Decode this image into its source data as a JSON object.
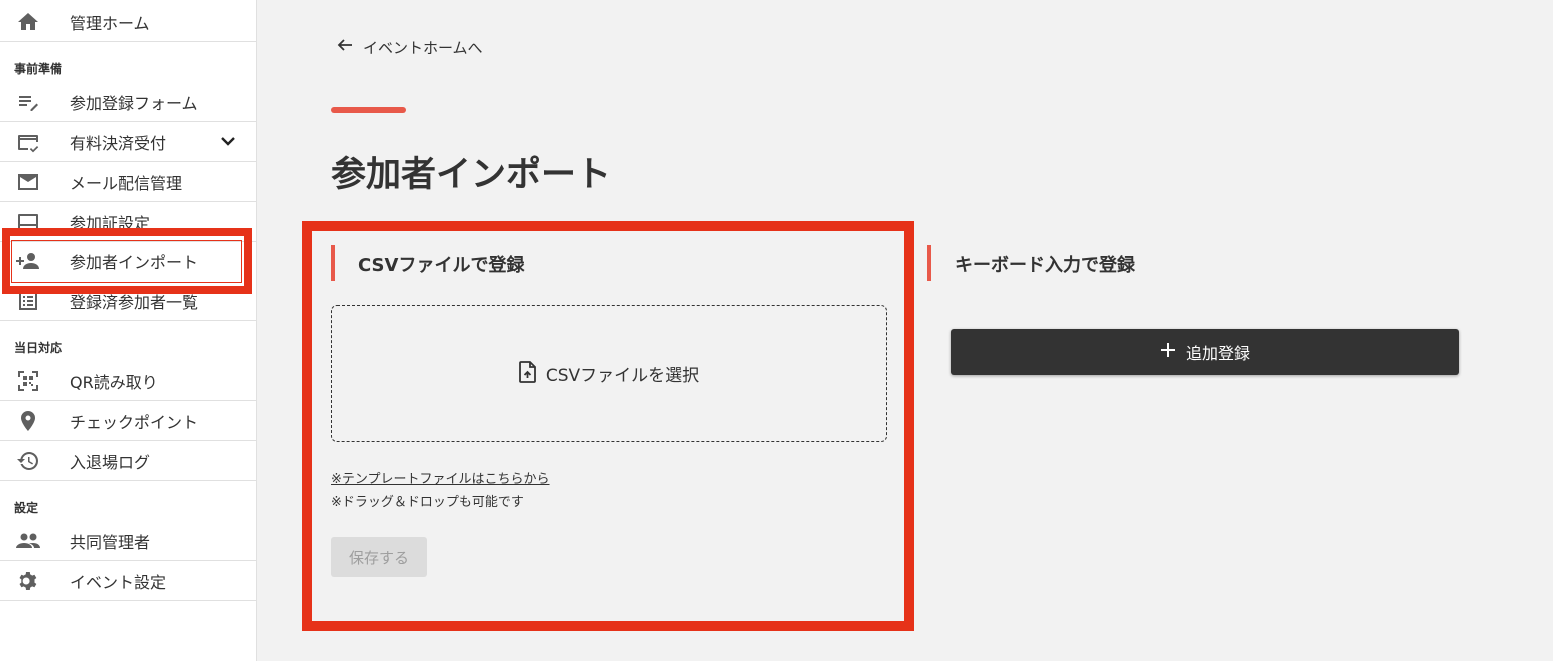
{
  "sidebar": {
    "items": [
      {
        "label": "管理ホーム",
        "icon": "home-icon"
      },
      {
        "label": "参加登録フォーム",
        "icon": "edit-note-icon"
      },
      {
        "label": "有料決済受付",
        "icon": "credit-card-check-icon"
      },
      {
        "label": "メール配信管理",
        "icon": "mail-icon"
      },
      {
        "label": "参加証設定",
        "icon": "card-icon"
      },
      {
        "label": "参加者インポート",
        "icon": "person-add-icon"
      },
      {
        "label": "登録済参加者一覧",
        "icon": "list-icon"
      },
      {
        "label": "QR読み取り",
        "icon": "qr-scan-icon"
      },
      {
        "label": "チェックポイント",
        "icon": "location-pin-icon"
      },
      {
        "label": "入退場ログ",
        "icon": "history-icon"
      },
      {
        "label": "共同管理者",
        "icon": "people-icon"
      },
      {
        "label": "イベント設定",
        "icon": "gear-icon"
      }
    ],
    "sections": {
      "prep": "事前準備",
      "dayof": "当日対応",
      "settings": "設定"
    },
    "selected": "参加者インポート"
  },
  "main": {
    "back_label": "イベントホームへ",
    "page_title": "参加者インポート",
    "csv": {
      "title": "CSVファイルで登録",
      "select_label": "CSVファイルを選択",
      "template_link": "※テンプレートファイルはこちらから",
      "drag_note": "※ドラッグ＆ドロップも可能です",
      "save_label": "保存する"
    },
    "keyboard": {
      "title": "キーボード入力で登録",
      "add_label": "追加登録"
    }
  },
  "colors": {
    "accent": "#e8594a",
    "highlight": "#e63219",
    "dark_button": "#333333",
    "disabled_button": "#dcdcdc"
  }
}
